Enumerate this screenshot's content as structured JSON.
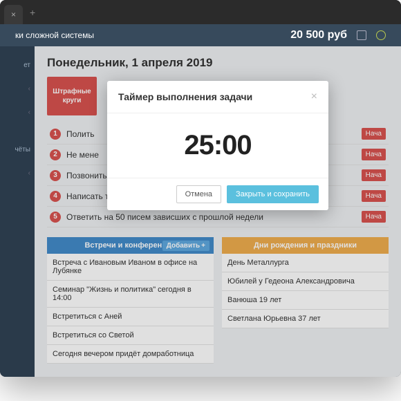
{
  "tab": {
    "close": "×",
    "plus": "+"
  },
  "header": {
    "subtitle": "ки сложной системы",
    "balance": "20 500 руб"
  },
  "sidebar": {
    "item1": "ет",
    "item2": "чёты"
  },
  "date": "Понедельник, 1 апреля 2019",
  "penalty": "Штрафные круги",
  "tasks": [
    {
      "n": "1",
      "t": "Полить",
      "b": "Нача"
    },
    {
      "n": "2",
      "t": "Не мене",
      "b": "Нача"
    },
    {
      "n": "3",
      "t": "Позвонить маме",
      "b": "Нача"
    },
    {
      "n": "4",
      "t": "Написать три новых стиха",
      "b": "Нача"
    },
    {
      "n": "5",
      "t": "Ответить на 50 писем зависших с прошлой недели",
      "b": "Нача"
    }
  ],
  "meetings": {
    "title": "Встречи и конференции",
    "add": "Добавить",
    "items": [
      "Встреча с Ивановым Иваном в офисе на Лубянке",
      "Семинар \"Жизнь и политика\" сегодня в 14:00",
      "Встретиться с Аней",
      "Встретиться со Светой",
      "Сегодня вечером придёт домработница"
    ]
  },
  "birthdays": {
    "title": "Дни рождения и праздники",
    "items": [
      "День Металлурга",
      "Юбилей у Гедеона Александровича",
      "Ванюша 19 лет",
      "Светлана Юрьевна 37 лет"
    ]
  },
  "modal": {
    "title": "Таймер выполнения задачи",
    "close": "×",
    "timer": "25:00",
    "cancel": "Отмена",
    "save": "Закрыть и сохранить"
  }
}
